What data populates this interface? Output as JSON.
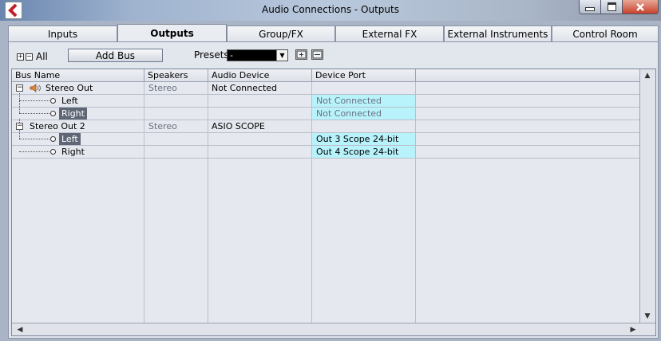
{
  "window": {
    "title": "Audio Connections - Outputs"
  },
  "tabs": [
    {
      "label": "Inputs"
    },
    {
      "label": "Outputs"
    },
    {
      "label": "Group/FX"
    },
    {
      "label": "External FX"
    },
    {
      "label": "External Instruments"
    },
    {
      "label": "Control Room"
    }
  ],
  "toolbar": {
    "all_label": "All",
    "add_bus_label": "Add Bus",
    "presets_label": "Presets",
    "preset_value": "-"
  },
  "table": {
    "columns": [
      "Bus Name",
      "Speakers",
      "Audio Device",
      "Device Port"
    ],
    "rows": [
      {
        "name": "Stereo Out",
        "speakers": "Stereo",
        "device": "Not Connected",
        "port": ""
      },
      {
        "name": "Left",
        "speakers": "",
        "device": "",
        "port": "Not Connected"
      },
      {
        "name": "Right",
        "speakers": "",
        "device": "",
        "port": "Not Connected"
      },
      {
        "name": "Stereo Out 2",
        "speakers": "Stereo",
        "device": "ASIO SCOPE",
        "port": ""
      },
      {
        "name": "Left",
        "speakers": "",
        "device": "",
        "port": "Out 3 Scope 24-bit"
      },
      {
        "name": "Right",
        "speakers": "",
        "device": "",
        "port": "Out 4 Scope 24-bit"
      }
    ]
  },
  "colors": {
    "port_highlight": "#b8f2fb",
    "selected_label": "#5f6675",
    "close_button": "#c7422b"
  },
  "icons": [
    "app-logo-icon",
    "minimize-icon",
    "maximize-icon",
    "close-icon",
    "speaker-icon",
    "expand-all-icon",
    "collapse-all-icon",
    "dropdown-arrow-icon",
    "save-preset-icon",
    "delete-preset-icon"
  ]
}
